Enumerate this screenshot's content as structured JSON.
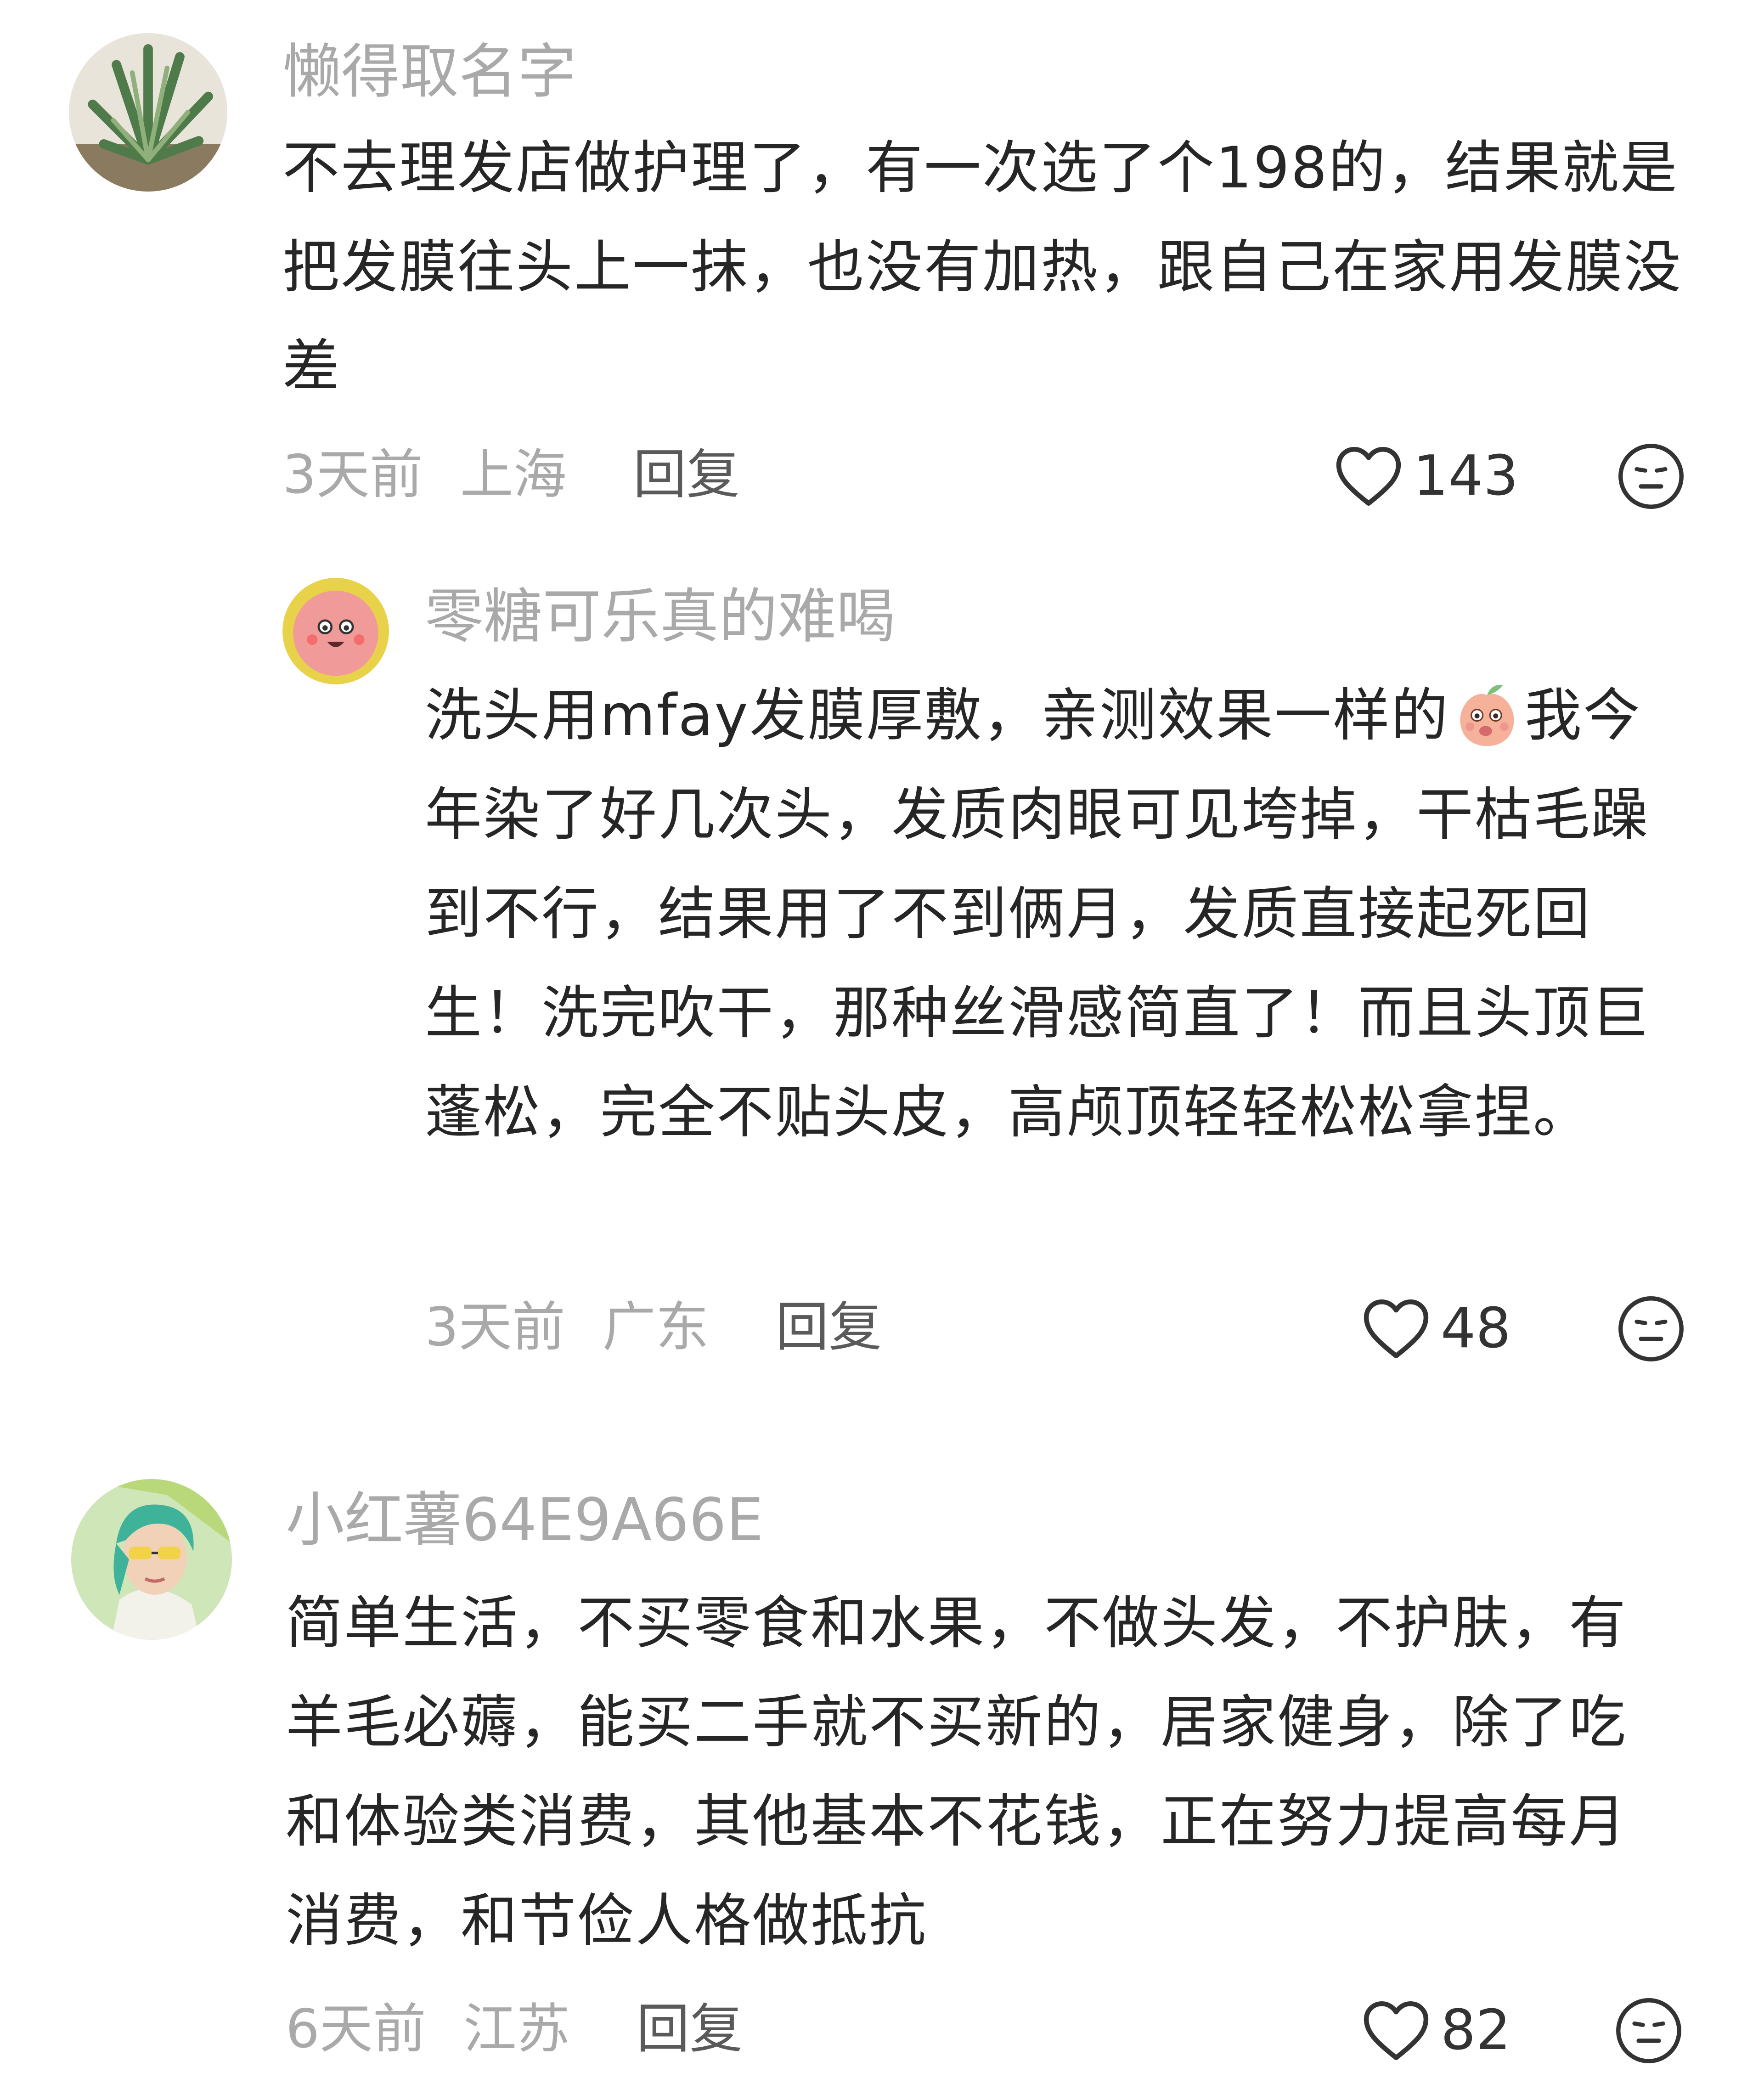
{
  "comments": [
    {
      "username": "懒得取名字",
      "avatar_icon": "succulent-plant-avatar",
      "text": "不去理发店做护理了，有一次选了个198的，结果就是把发膜往头上一抹，也没有加热，跟自己在家用发膜没差",
      "time": "3天前",
      "location": "上海",
      "reply_label": "回复",
      "likes": "143"
    },
    {
      "username": "零糖可乐真的难喝",
      "avatar_icon": "cartoon-baby-face-avatar",
      "text_part1": "洗头用mfay发膜厚敷，亲测效果一样的",
      "emoji_icon": "peach-face-emoji",
      "text_part2": "我今年染了好几次头，发质肉眼可见垮掉，干枯毛躁到不行，结果用了不到俩月，发质直接起死回生！洗完吹干，那种丝滑感简直了！而且头顶巨蓬松，完全不贴头皮，高颅顶轻轻松松拿捏。",
      "time": "3天前",
      "location": "广东",
      "reply_label": "回复",
      "likes": "48"
    },
    {
      "username": "小红薯64E9A66E",
      "avatar_icon": "green-hair-girl-avatar",
      "text": "简单生活，不买零食和水果，不做头发，不护肤，有羊毛必薅，能买二手就不买新的，居家健身，除了吃和体验类消费，其他基本不花钱，正在努力提高每月消费，和节俭人格做抵抗",
      "time": "6天前",
      "location": "江苏",
      "reply_label": "回复",
      "likes": "82"
    }
  ],
  "icons": {
    "like": "heart-outline-icon",
    "dislike": "neutral-face-icon"
  },
  "colors": {
    "username": "#a9a9a9",
    "body_text": "#262626",
    "meta": "#a9a9a9",
    "reply": "#5a5a5a"
  }
}
